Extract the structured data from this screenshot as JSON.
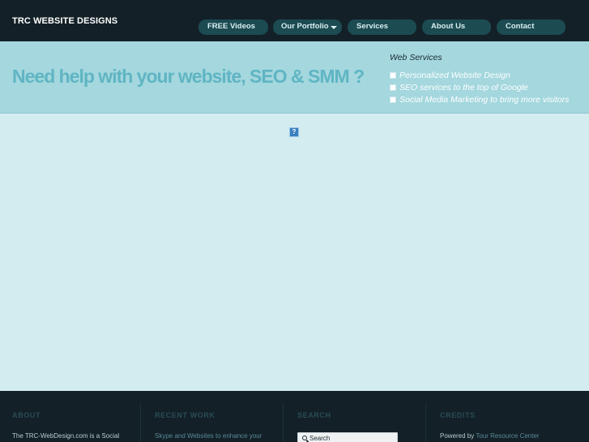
{
  "header": {
    "site_title": "TRC WEBSITE DESIGNS",
    "nav": [
      {
        "label": "FREE Videos"
      },
      {
        "label": "Our Portfolio"
      },
      {
        "label": "Services"
      },
      {
        "label": "About Us"
      },
      {
        "label": "Contact"
      }
    ]
  },
  "hero": {
    "headline": "Need help with your website, SEO & SMM ?",
    "services_title": "Web Services",
    "services": [
      "Personalized Website Design",
      "SEO services to the top of Google",
      "Social Media Marketing to bring more visitors"
    ]
  },
  "main": {
    "broken_image_glyph": "?"
  },
  "footer": {
    "about": {
      "heading": "ABOUT",
      "text": "The TRC-WebDesign.com is a Social"
    },
    "recent_work": {
      "heading": "RECENT WORK",
      "text": "Skype and Websites to enhance your"
    },
    "search": {
      "heading": "SEARCH",
      "placeholder": "Search"
    },
    "credits": {
      "heading": "CREDITS",
      "powered_by": "Powered by",
      "link": "Tour Resource Center"
    }
  },
  "colors": {
    "topbar": "#132027",
    "nav_pill": "#1c4b52",
    "hero": "#a4d7de",
    "headline": "#5fb5c3",
    "content_bg": "#d3ecf0"
  }
}
